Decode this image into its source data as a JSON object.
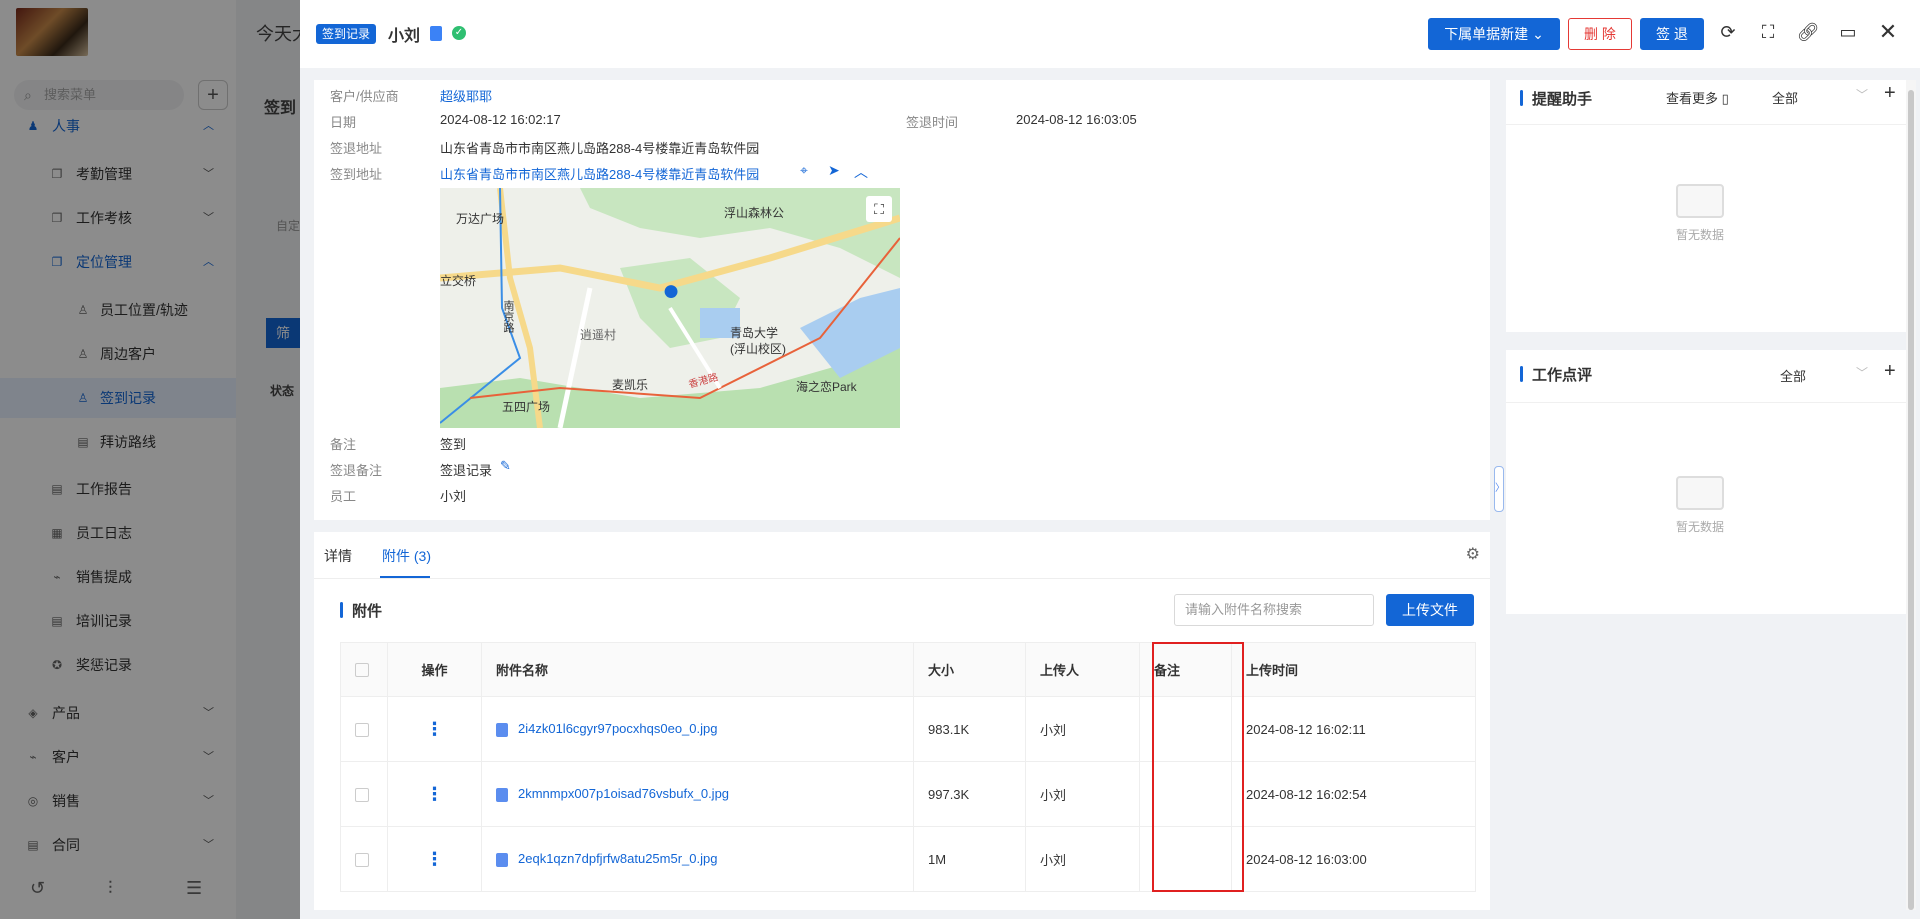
{
  "background": {
    "header_text": "今天大",
    "search_placeholder": "搜索菜单",
    "page_title_partial": "签到",
    "filter_btn_partial": "筛",
    "custom_partial": "自定",
    "status_col_partial": "状态",
    "menu": [
      {
        "label": "人事",
        "icon": "person-icon"
      },
      {
        "label": "考勤管理",
        "icon": "copy-icon"
      },
      {
        "label": "工作考核",
        "icon": "copy-icon"
      },
      {
        "label": "定位管理",
        "icon": "copy-icon"
      },
      {
        "label": "员工位置/轨迹",
        "icon": "user-location-icon"
      },
      {
        "label": "周边客户",
        "icon": "user-location-icon"
      },
      {
        "label": "签到记录",
        "icon": "user-location-icon"
      },
      {
        "label": "拜访路线",
        "icon": "document-icon"
      },
      {
        "label": "工作报告",
        "icon": "document-icon"
      },
      {
        "label": "员工日志",
        "icon": "calendar-icon"
      },
      {
        "label": "销售提成",
        "icon": "chart-icon"
      },
      {
        "label": "培训记录",
        "icon": "document-icon"
      },
      {
        "label": "奖惩记录",
        "icon": "award-icon"
      },
      {
        "label": "产品",
        "icon": "cube-icon"
      },
      {
        "label": "客户",
        "icon": "chart-icon"
      },
      {
        "label": "销售",
        "icon": "target-icon"
      },
      {
        "label": "合同",
        "icon": "document-icon"
      }
    ]
  },
  "drawer": {
    "tag": "签到记录",
    "title": "小刘",
    "buttons": {
      "new_sub": "下属单据新建",
      "delete": "删 除",
      "sign_out": "签 退"
    }
  },
  "detail": {
    "customer_label": "客户/供应商",
    "customer_value": "超级耶耶",
    "date_label": "日期",
    "date_value": "2024-08-12 16:02:17",
    "signout_time_label": "签退时间",
    "signout_time_value": "2024-08-12 16:03:05",
    "signout_addr_label": "签退地址",
    "signout_addr_value": "山东省青岛市市南区燕儿岛路288-4号楼靠近青岛软件园",
    "signin_addr_label": "签到地址",
    "signin_addr_value": "山东省青岛市市南区燕儿岛路288-4号楼靠近青岛软件园",
    "remark_label": "备注",
    "remark_value": "签到",
    "signout_remark_label": "签退备注",
    "signout_remark_value": "签退记录",
    "employee_label": "员工",
    "employee_value": "小刘"
  },
  "map": {
    "pois": [
      "万达广场",
      "浮山森林公",
      "立交桥",
      "南京路",
      "逍遥村",
      "青岛大学",
      "(浮山校区)",
      "麦凯乐",
      "五四广场",
      "海之恋Park",
      "香港路"
    ]
  },
  "attachments": {
    "tabs": [
      "详情",
      "附件 (3)"
    ],
    "section_title": "附件",
    "search_placeholder": "请输入附件名称搜索",
    "upload_label": "上传文件",
    "columns": [
      "操作",
      "附件名称",
      "大小",
      "上传人",
      "备注",
      "上传时间"
    ],
    "rows": [
      {
        "name": "2i4zk01l6cgyr97pocxhqs0eo_0.jpg",
        "size": "983.1K",
        "uploader": "小刘",
        "remark": "",
        "time": "2024-08-12 16:02:11"
      },
      {
        "name": "2kmnmpx007p1oisad76vsbufx_0.jpg",
        "size": "997.3K",
        "uploader": "小刘",
        "remark": "",
        "time": "2024-08-12 16:02:54"
      },
      {
        "name": "2eqk1qzn7dpfjrfw8atu25m5r_0.jpg",
        "size": "1M",
        "uploader": "小刘",
        "remark": "",
        "time": "2024-08-12 16:03:00"
      }
    ]
  },
  "reminder": {
    "title": "提醒助手",
    "more": "查看更多",
    "filter": "全部",
    "empty": "暂无数据"
  },
  "review": {
    "title": "工作点评",
    "filter": "全部",
    "empty": "暂无数据"
  },
  "colors": {
    "primary": "#1366d6",
    "danger": "#e53935",
    "success": "#2fbf71",
    "highlight_box": "#e02020"
  }
}
